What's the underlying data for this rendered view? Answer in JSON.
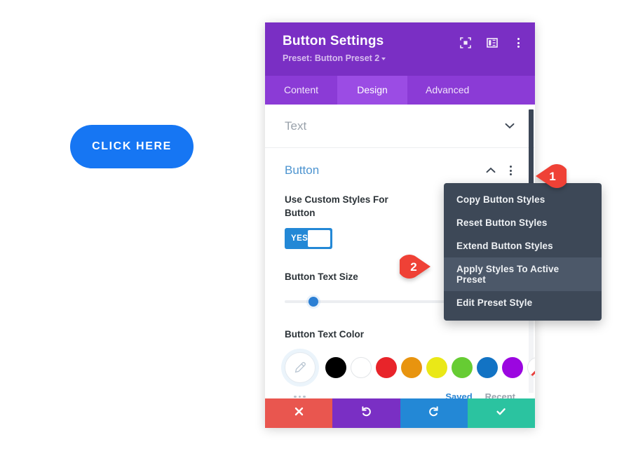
{
  "canvas": {
    "cta_button": {
      "label": "CLICK HERE",
      "color": "#1676f3",
      "text_color": "#ffffff"
    }
  },
  "modal": {
    "title": "Button Settings",
    "preset_label": "Preset: Button Preset 2",
    "header_color": "#7a2fc4",
    "header_icons": [
      {
        "name": "focus-target-icon"
      },
      {
        "name": "layout-panel-icon"
      },
      {
        "name": "kebab-menu-icon"
      }
    ],
    "tabs": [
      {
        "label": "Content",
        "active": false
      },
      {
        "label": "Design",
        "active": true
      },
      {
        "label": "Advanced",
        "active": false
      }
    ],
    "sections": {
      "text": {
        "label": "Text",
        "expanded": false
      },
      "button": {
        "label": "Button",
        "expanded": true,
        "accent": "#4d94d0"
      }
    },
    "fields": {
      "custom_styles": {
        "label": "Use Custom Styles For Button",
        "toggle_value": "YES",
        "toggle_color": "#2388d6"
      },
      "text_size": {
        "label": "Button Text Size",
        "slider_percent": 18,
        "thumb_color": "#2b7fd4"
      },
      "text_color": {
        "label": "Button Text Color",
        "picker_icon": "eyedropper-icon",
        "swatches": [
          {
            "name": "black",
            "hex": "#000000"
          },
          {
            "name": "white",
            "hex": "#ffffff"
          },
          {
            "name": "red",
            "hex": "#e8242a"
          },
          {
            "name": "orange",
            "hex": "#e8940f"
          },
          {
            "name": "yellow",
            "hex": "#eae817"
          },
          {
            "name": "green",
            "hex": "#66cc33"
          },
          {
            "name": "blue",
            "hex": "#1273c4"
          },
          {
            "name": "purple",
            "hex": "#9b06e0"
          },
          {
            "name": "none",
            "hex": "transparent"
          }
        ],
        "more_icon": "ellipsis-icon",
        "tabs": [
          {
            "label": "Saved",
            "active": true
          },
          {
            "label": "Recent",
            "active": false
          }
        ]
      }
    },
    "footer_buttons": [
      {
        "name": "cancel",
        "icon": "close-icon",
        "color": "#e9564f"
      },
      {
        "name": "undo",
        "icon": "undo-icon",
        "color": "#7a2fc4"
      },
      {
        "name": "redo",
        "icon": "redo-icon",
        "color": "#2388d6"
      },
      {
        "name": "save",
        "icon": "check-icon",
        "color": "#2bc3a0"
      }
    ]
  },
  "context_menu": {
    "background": "#3d4857",
    "items": [
      {
        "label": "Copy Button Styles",
        "active": false
      },
      {
        "label": "Reset Button Styles",
        "active": false
      },
      {
        "label": "Extend Button Styles",
        "active": false
      },
      {
        "label": "Apply Styles To Active Preset",
        "active": true
      },
      {
        "label": "Edit Preset Style",
        "active": false
      }
    ]
  },
  "annotations": {
    "color": "#ef4136",
    "pins": [
      {
        "number": "1",
        "points": "left"
      },
      {
        "number": "2",
        "points": "right"
      }
    ]
  }
}
